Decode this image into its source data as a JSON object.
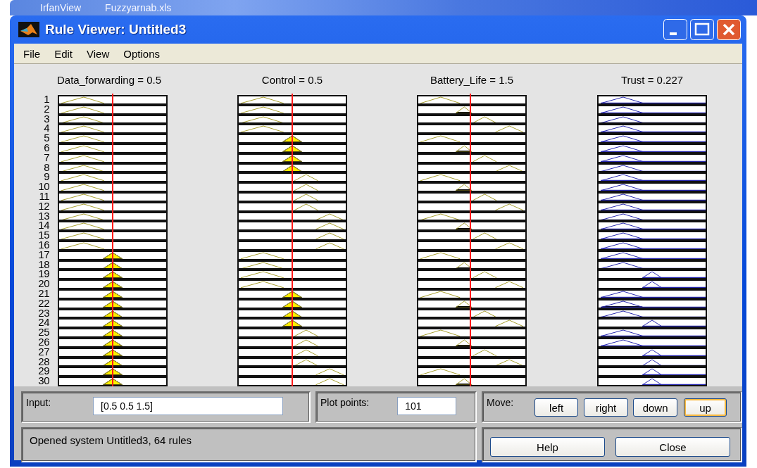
{
  "taskbar": {
    "items": [
      "IrfanView",
      "Fuzzyarnab.xls"
    ]
  },
  "window": {
    "title": "Rule Viewer: Untitled3"
  },
  "menu": [
    "File",
    "Edit",
    "View",
    "Options"
  ],
  "variables": [
    {
      "label": "Data_forwarding = 0.5",
      "kind": "input",
      "level": 0.5
    },
    {
      "label": "Control = 0.5",
      "kind": "input",
      "level": 0.5
    },
    {
      "label": "Battery_Life = 1.5",
      "kind": "input",
      "level": 0.49
    },
    {
      "label": "Trust = 0.227",
      "kind": "output"
    }
  ],
  "rules": [
    {
      "number": "1",
      "cells": [
        {
          "kind": "low"
        },
        {
          "kind": "low"
        },
        {
          "kind": "low"
        },
        {
          "kind": "low"
        }
      ]
    },
    {
      "number": "2",
      "cells": [
        {
          "kind": "low"
        },
        {
          "kind": "low"
        },
        {
          "kind": "medium"
        },
        {
          "kind": "low"
        }
      ]
    },
    {
      "number": "3",
      "cells": [
        {
          "kind": "low"
        },
        {
          "kind": "low"
        },
        {
          "kind": "high"
        },
        {
          "kind": "low"
        }
      ]
    },
    {
      "number": "4",
      "cells": [
        {
          "kind": "low"
        },
        {
          "kind": "low"
        },
        {
          "kind": "very_high"
        },
        {
          "kind": "low"
        }
      ]
    },
    {
      "number": "5",
      "cells": [
        {
          "kind": "low"
        },
        {
          "kind": "medium"
        },
        {
          "kind": "low"
        },
        {
          "kind": "low"
        }
      ]
    },
    {
      "number": "6",
      "cells": [
        {
          "kind": "low"
        },
        {
          "kind": "medium"
        },
        {
          "kind": "medium"
        },
        {
          "kind": "low"
        }
      ]
    },
    {
      "number": "7",
      "cells": [
        {
          "kind": "low"
        },
        {
          "kind": "medium"
        },
        {
          "kind": "high"
        },
        {
          "kind": "low"
        }
      ]
    },
    {
      "number": "8",
      "cells": [
        {
          "kind": "low"
        },
        {
          "kind": "medium"
        },
        {
          "kind": "very_high"
        },
        {
          "kind": "low"
        }
      ]
    },
    {
      "number": "9",
      "cells": [
        {
          "kind": "low"
        },
        {
          "kind": "high"
        },
        {
          "kind": "low"
        },
        {
          "kind": "low"
        }
      ]
    },
    {
      "number": "10",
      "cells": [
        {
          "kind": "low"
        },
        {
          "kind": "high"
        },
        {
          "kind": "medium"
        },
        {
          "kind": "low"
        }
      ]
    },
    {
      "number": "11",
      "cells": [
        {
          "kind": "low"
        },
        {
          "kind": "high"
        },
        {
          "kind": "high"
        },
        {
          "kind": "low"
        }
      ]
    },
    {
      "number": "12",
      "cells": [
        {
          "kind": "low"
        },
        {
          "kind": "high"
        },
        {
          "kind": "very_high"
        },
        {
          "kind": "low"
        }
      ]
    },
    {
      "number": "13",
      "cells": [
        {
          "kind": "low"
        },
        {
          "kind": "very_high"
        },
        {
          "kind": "low"
        },
        {
          "kind": "low"
        }
      ]
    },
    {
      "number": "14",
      "cells": [
        {
          "kind": "low"
        },
        {
          "kind": "very_high"
        },
        {
          "kind": "medium"
        },
        {
          "kind": "low"
        }
      ]
    },
    {
      "number": "15",
      "cells": [
        {
          "kind": "low"
        },
        {
          "kind": "very_high"
        },
        {
          "kind": "high"
        },
        {
          "kind": "low"
        }
      ]
    },
    {
      "number": "16",
      "cells": [
        {
          "kind": "low"
        },
        {
          "kind": "very_high"
        },
        {
          "kind": "very_high"
        },
        {
          "kind": "low"
        }
      ]
    },
    {
      "number": "17",
      "cells": [
        {
          "kind": "medium"
        },
        {
          "kind": "low"
        },
        {
          "kind": "low"
        },
        {
          "kind": "low"
        }
      ]
    },
    {
      "number": "18",
      "cells": [
        {
          "kind": "medium"
        },
        {
          "kind": "low"
        },
        {
          "kind": "medium"
        },
        {
          "kind": "low"
        }
      ]
    },
    {
      "number": "19",
      "cells": [
        {
          "kind": "medium"
        },
        {
          "kind": "low"
        },
        {
          "kind": "high"
        },
        {
          "kind": "medium"
        }
      ]
    },
    {
      "number": "20",
      "cells": [
        {
          "kind": "medium"
        },
        {
          "kind": "low"
        },
        {
          "kind": "very_high"
        },
        {
          "kind": "medium"
        }
      ]
    },
    {
      "number": "21",
      "cells": [
        {
          "kind": "medium"
        },
        {
          "kind": "medium"
        },
        {
          "kind": "low"
        },
        {
          "kind": "low"
        }
      ]
    },
    {
      "number": "22",
      "cells": [
        {
          "kind": "medium"
        },
        {
          "kind": "medium"
        },
        {
          "kind": "medium"
        },
        {
          "kind": "low"
        }
      ]
    },
    {
      "number": "23",
      "cells": [
        {
          "kind": "medium"
        },
        {
          "kind": "medium"
        },
        {
          "kind": "high"
        },
        {
          "kind": "low"
        }
      ]
    },
    {
      "number": "24",
      "cells": [
        {
          "kind": "medium"
        },
        {
          "kind": "medium"
        },
        {
          "kind": "very_high"
        },
        {
          "kind": "medium"
        }
      ]
    },
    {
      "number": "25",
      "cells": [
        {
          "kind": "medium"
        },
        {
          "kind": "high"
        },
        {
          "kind": "low"
        },
        {
          "kind": "low"
        }
      ]
    },
    {
      "number": "26",
      "cells": [
        {
          "kind": "medium"
        },
        {
          "kind": "high"
        },
        {
          "kind": "medium"
        },
        {
          "kind": "low"
        }
      ]
    },
    {
      "number": "27",
      "cells": [
        {
          "kind": "medium"
        },
        {
          "kind": "high"
        },
        {
          "kind": "high"
        },
        {
          "kind": "medium"
        }
      ]
    },
    {
      "number": "28",
      "cells": [
        {
          "kind": "medium"
        },
        {
          "kind": "high"
        },
        {
          "kind": "very_high"
        },
        {
          "kind": "medium"
        }
      ]
    },
    {
      "number": "29",
      "cells": [
        {
          "kind": "medium"
        },
        {
          "kind": "very_high"
        },
        {
          "kind": "low"
        },
        {
          "kind": "medium"
        }
      ]
    },
    {
      "number": "30",
      "cells": [
        {
          "kind": "medium"
        },
        {
          "kind": "very_high"
        },
        {
          "kind": "medium"
        },
        {
          "kind": "medium"
        }
      ]
    }
  ],
  "input": {
    "label": "Input:",
    "value": "[0.5 0.5 1.5]"
  },
  "plot_points": {
    "label": "Plot points:",
    "value": "101"
  },
  "move": {
    "label": "Move:",
    "buttons": [
      {
        "label": "left",
        "focused": false
      },
      {
        "label": "right",
        "focused": false
      },
      {
        "label": "down",
        "focused": false
      },
      {
        "label": "up",
        "focused": true
      }
    ]
  },
  "status": "Opened system Untitled3, 64 rules",
  "buttons": [
    "Help",
    "Close"
  ]
}
